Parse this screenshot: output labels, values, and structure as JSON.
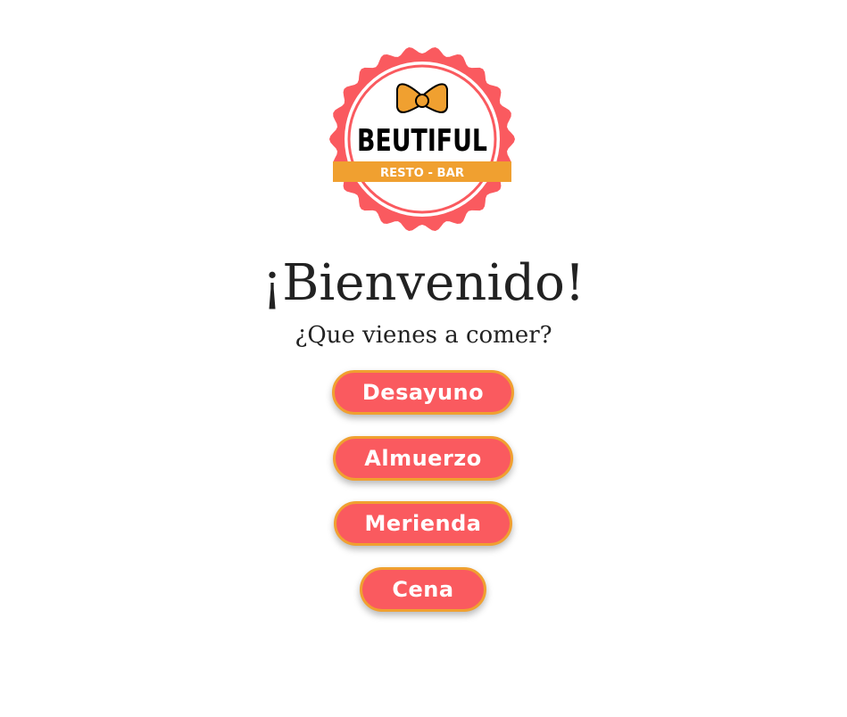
{
  "logo": {
    "brand": "BEUTIFUL",
    "tagline": "RESTO - BAR",
    "colors": {
      "badge": "#fa5a5f",
      "ribbon": "#f0a030",
      "bow": "#f0a030",
      "text": "#000000"
    }
  },
  "title": "¡Bienvenido!",
  "subtitle": "¿Que vienes a comer?",
  "menu": {
    "breakfast": "Desayuno",
    "lunch": "Almuerzo",
    "snack": "Merienda",
    "dinner": "Cena"
  },
  "colors": {
    "button": "#fa5a5f",
    "button_border": "#f0a030",
    "button_text": "#ffffff"
  }
}
